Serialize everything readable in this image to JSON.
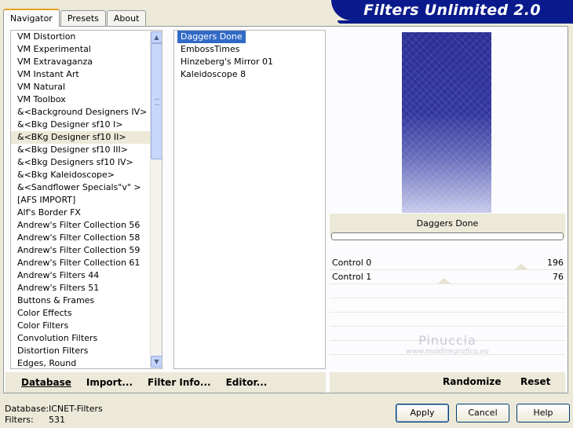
{
  "banner": {
    "title": "Filters Unlimited 2.0"
  },
  "tabs": [
    {
      "label": "Navigator",
      "active": true
    },
    {
      "label": "Presets",
      "active": false
    },
    {
      "label": "About",
      "active": false
    }
  ],
  "categories": {
    "items": [
      "VM Distortion",
      "VM Experimental",
      "VM Extravaganza",
      "VM Instant Art",
      "VM Natural",
      "VM Toolbox",
      "&<Background Designers IV>",
      "&<Bkg Designer sf10 I>",
      "&<BKg Designer sf10 II>",
      "&<Bkg Designer sf10 III>",
      "&<Bkg Designers sf10 IV>",
      "&<Bkg Kaleidoscope>",
      "&<Sandflower Specials\"v\" >",
      "[AFS IMPORT]",
      "Alf's Border FX",
      "Andrew's Filter Collection 56",
      "Andrew's Filter Collection 58",
      "Andrew's Filter Collection 59",
      "Andrew's Filter Collection 61",
      "Andrew's Filters 44",
      "Andrew's Filters 51",
      "Buttons & Frames",
      "Color Effects",
      "Color Filters",
      "Convolution Filters",
      "Distortion Filters",
      "Edges, Round"
    ],
    "selected_index": 8
  },
  "filters": {
    "items": [
      "Daggers Done",
      "EmbossTimes",
      "Hinzeberg's Mirror 01",
      "Kaleidoscope 8"
    ],
    "selected_index": 0
  },
  "preview": {
    "filter_name": "Daggers Done"
  },
  "controls": [
    {
      "label": "Control 0",
      "value": "196",
      "level": 196
    },
    {
      "label": "Control  1",
      "value": "76",
      "level": 76
    }
  ],
  "watermark": {
    "name": "Pinuccia",
    "site": "www.maidiregrafica.eu"
  },
  "toolbar": {
    "database": "Database",
    "import": "Import...",
    "filter_info": "Filter Info...",
    "editor": "Editor...",
    "randomize": "Randomize",
    "reset": "Reset"
  },
  "footer": {
    "database_label": "Database:",
    "database_value": "ICNET-Filters",
    "filters_label": "Filters:",
    "filters_value": "531"
  },
  "buttons": {
    "apply": "Apply",
    "cancel": "Cancel",
    "help": "Help"
  },
  "colors": {
    "banner": "#0a1a8c",
    "selection": "#316ac5",
    "tab_accent": "#e6a026"
  }
}
